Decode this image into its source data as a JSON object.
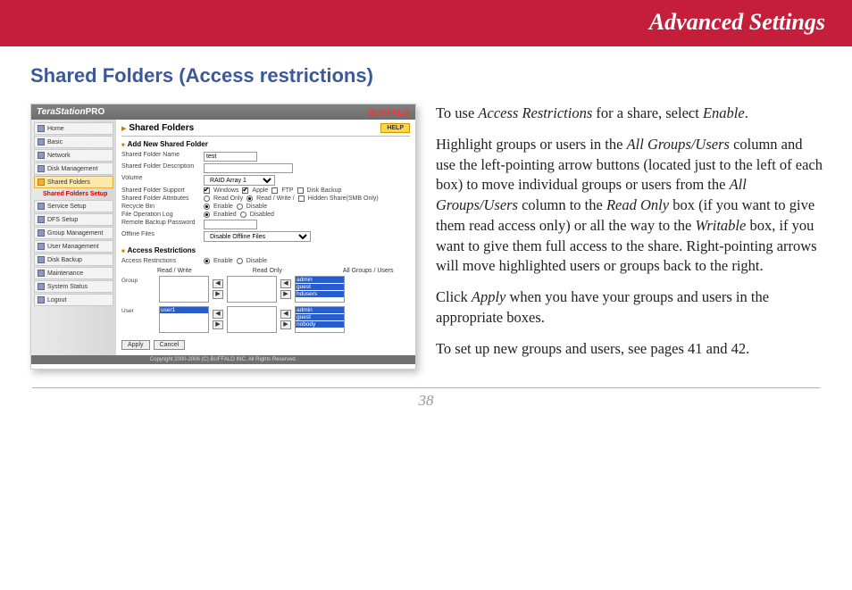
{
  "banner_title": "Advanced Settings",
  "section_title": "Shared Folders (Access restrictions)",
  "shot": {
    "logo_main": "TeraStation",
    "logo_suffix": "PRO",
    "brand": "BUFFALO",
    "help_label": "HELP",
    "panel_title": "Shared Folders",
    "sidebar": {
      "items": [
        {
          "label": "Home"
        },
        {
          "label": "Basic"
        },
        {
          "label": "Network"
        },
        {
          "label": "Disk Management"
        },
        {
          "label": "Shared Folders",
          "active": true
        },
        {
          "label": "Shared Folders Setup",
          "sub": true
        },
        {
          "label": "Service Setup"
        },
        {
          "label": "DFS Setup"
        },
        {
          "label": "Group Management"
        },
        {
          "label": "User Management"
        },
        {
          "label": "Disk Backup"
        },
        {
          "label": "Maintenance"
        },
        {
          "label": "System Status"
        },
        {
          "label": "Logout"
        }
      ]
    },
    "add_section": "Add New Shared Folder",
    "rows": {
      "name_lbl": "Shared Folder Name",
      "name_val": "test",
      "desc_lbl": "Shared Folder Description",
      "desc_val": "",
      "vol_lbl": "Volume",
      "vol_val": "RAID Array 1",
      "support_lbl": "Shared Folder Support",
      "sup_win": "Windows",
      "sup_apple": "Apple",
      "sup_ftp": "FTP",
      "sup_bk": "Disk Backup",
      "attr_lbl": "Shared Folder Attributes",
      "attr_ro": "Read Only",
      "attr_rw": "Read / Write /",
      "attr_hidden": "Hidden Share(SMB Only)",
      "recycle_lbl": "Recycle Bin",
      "enable": "Enable",
      "disable": "Disable",
      "oplog_lbl": "File Operation Log",
      "enabled": "Enabled",
      "disabled": "Disabled",
      "rbpw_lbl": "Remote Backup Password",
      "rbpw_val": "",
      "offline_lbl": "Offline Files",
      "offline_val": "Disable Offline Files"
    },
    "ar_section": "Access Restrictions",
    "ar_setting_lbl": "Access Restrictions",
    "col_rw": "Read / Write",
    "col_ro": "Read Only",
    "col_all": "All Groups / Users",
    "group_lbl": "Group",
    "user_lbl": "User",
    "group_all": [
      "admin",
      "guest",
      "hdusers"
    ],
    "user_rw": [
      "user1"
    ],
    "user_all": [
      "admin",
      "guest",
      "nobody"
    ],
    "apply": "Apply",
    "cancel": "Cancel",
    "footer": "Copyright 2000-2006 (C) BUFFALO INC. All Rights Reserved."
  },
  "body": {
    "p1_a": "To use ",
    "p1_em1": "Access Restrictions",
    "p1_b": " for a share, select ",
    "p1_em2": "Enable",
    "p1_c": ".",
    "p2_a": "Highlight groups or users in the ",
    "p2_em1": "All Groups/Users",
    "p2_b": " column and use the left-pointing arrow buttons (located just to the left of each box) to move individual groups or users from the ",
    "p2_em2": "All Groups/Users",
    "p2_c": " column to the ",
    "p2_em3": "Read Only",
    "p2_d": " box (if you want to give them read access only) or all the way to the ",
    "p2_em4": "Writable",
    "p2_e": " box, if you want to give them full access to the share.  Right-pointing arrows will move highlighted users or groups back to the right.",
    "p3_a": "Click ",
    "p3_em1": "Apply",
    "p3_b": " when you have your groups and users in the appropriate boxes.",
    "p4": "To set up new groups and users, see pages 41 and 42."
  },
  "page_number": "38"
}
